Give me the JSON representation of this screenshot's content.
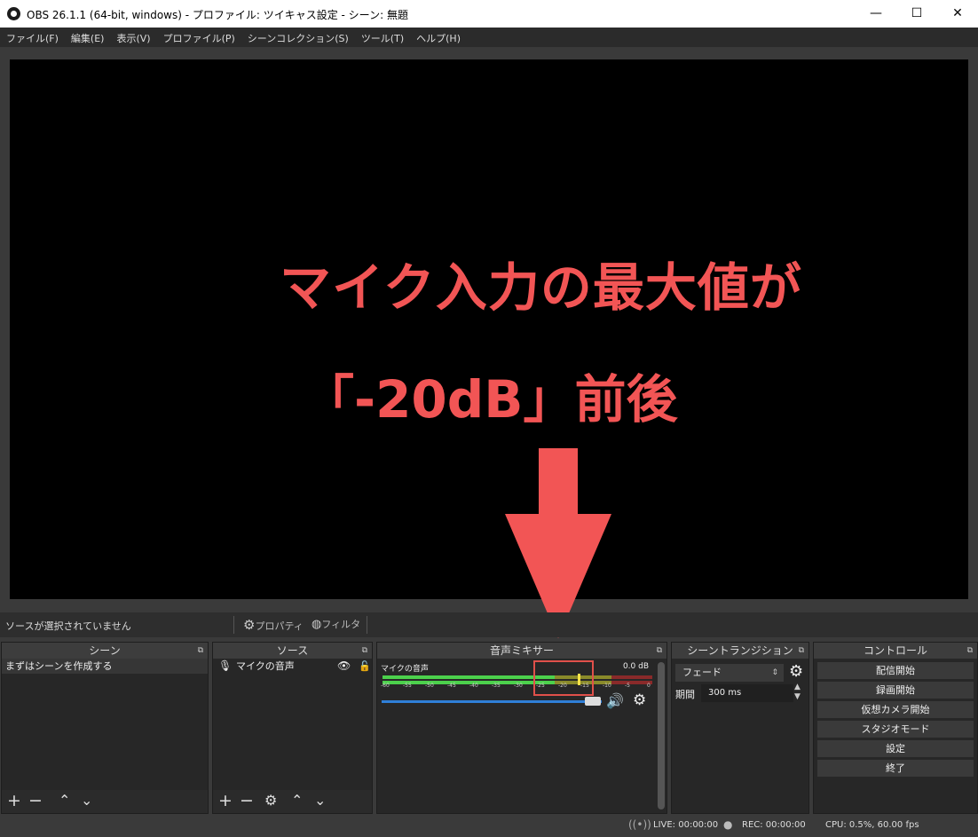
{
  "window": {
    "title": "OBS 26.1.1 (64-bit, windows) - プロファイル: ツイキャス設定 - シーン: 無題",
    "minimize": "—",
    "maximize": "☐",
    "close": "✕"
  },
  "menu": [
    "ファイル(F)",
    "編集(E)",
    "表示(V)",
    "プロファイル(P)",
    "シーンコレクション(S)",
    "ツール(T)",
    "ヘルプ(H)"
  ],
  "overlay": {
    "line1": "マイク入力の最大値が",
    "line2": "「-20dB」前後",
    "color": "#f25555"
  },
  "source_bar": {
    "no_selection": "ソースが選択されていません",
    "properties": "プロパティ",
    "filters": "フィルタ"
  },
  "scenes": {
    "header": "シーン",
    "item": "まずはシーンを作成する"
  },
  "sources": {
    "header": "ソース",
    "item": "マイクの音声"
  },
  "mixer": {
    "header": "音声ミキサー",
    "channel": "マイクの音声",
    "level": "0.0 dB",
    "ticks": [
      "-60",
      "-55",
      "-50",
      "-45",
      "-40",
      "-35",
      "-30",
      "-25",
      "-20",
      "-15",
      "-10",
      "-5",
      "0"
    ],
    "volume_fraction": 1.0
  },
  "transitions": {
    "header": "シーントランジション",
    "selected": "フェード",
    "duration_label": "期間",
    "duration_value": "300 ms"
  },
  "controls": {
    "header": "コントロール",
    "buttons": [
      "配信開始",
      "録画開始",
      "仮想カメラ開始",
      "スタジオモード",
      "設定",
      "終了"
    ]
  },
  "status": {
    "live": "LIVE: 00:00:00",
    "rec": "REC: 00:00:00",
    "cpu": "CPU: 0.5%, 60.00 fps"
  },
  "colors": {
    "meter_green": "#4cd14c",
    "meter_yellow": "#c8c83a",
    "meter_red": "#c23a3a",
    "highlight_box": "#e0504a",
    "slider_blue": "#2f7fd8"
  }
}
